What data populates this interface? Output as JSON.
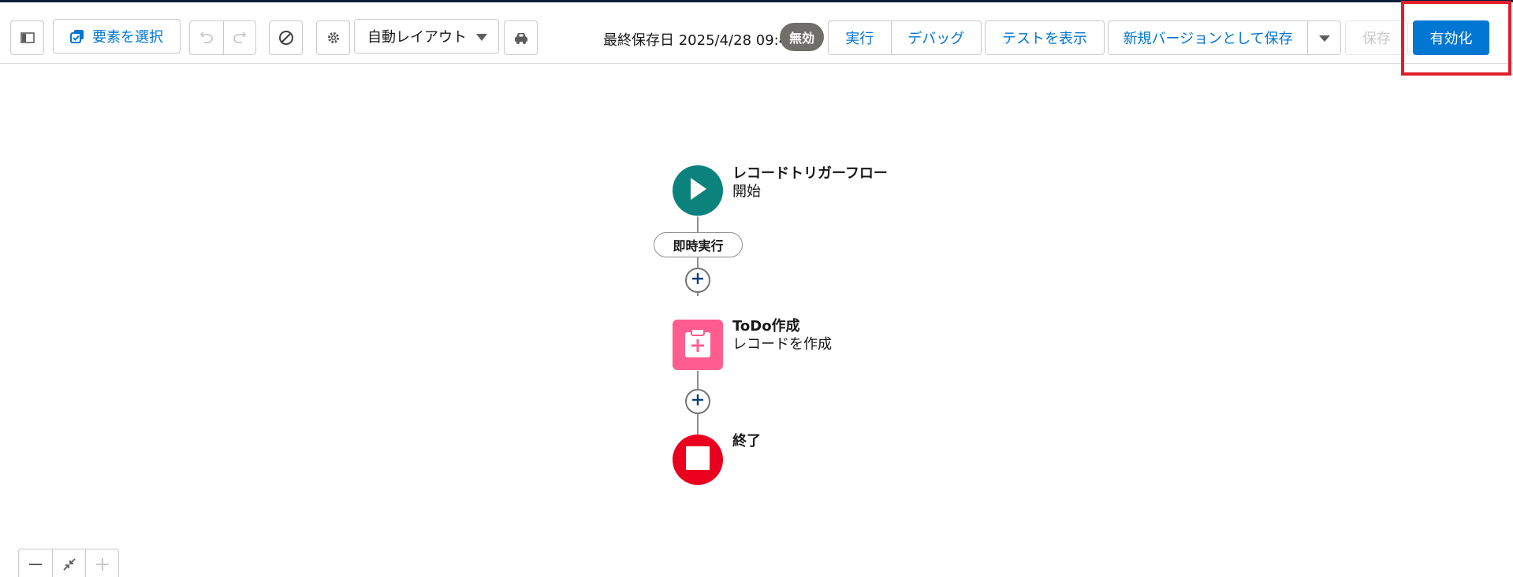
{
  "toolbar": {
    "select_elements_label": "要素を選択",
    "layout_select_value": "自動レイアウト",
    "saved_info": "最終保存日 2025/4/28 09:41",
    "status_badge": "無効",
    "run_label": "実行",
    "debug_label": "デバッグ",
    "view_tests_label": "テストを表示",
    "save_as_new_version_label": "新規バージョンとして保存",
    "save_label": "保存",
    "activate_label": "有効化"
  },
  "flow": {
    "start": {
      "title": "レコードトリガーフロー",
      "subtitle": "開始"
    },
    "path_label": "即時実行",
    "create_record": {
      "title": "ToDo作成",
      "subtitle": "レコードを作成"
    },
    "end": {
      "title": "終了"
    }
  },
  "colors": {
    "brand_blue": "#0176d3",
    "start_node": "#0b827c",
    "create_node": "#ff5d8f",
    "end_node": "#ea001e",
    "badge_gray": "#706e6b",
    "highlight_red": "#e01e2a"
  },
  "icons": {
    "panel_toggle": "panel-toggle-icon",
    "select_elements": "checkbox-stack-icon",
    "undo": "undo-icon",
    "redo": "redo-icon",
    "ban": "ban-icon",
    "settings": "gear-icon",
    "vehicle": "car-icon",
    "start": "play-icon",
    "create": "clipboard-plus-icon",
    "end": "stop-icon",
    "add": "plus-icon",
    "zoom_out": "minus-icon",
    "fit": "collapse-icon",
    "zoom_in": "plus-icon"
  }
}
